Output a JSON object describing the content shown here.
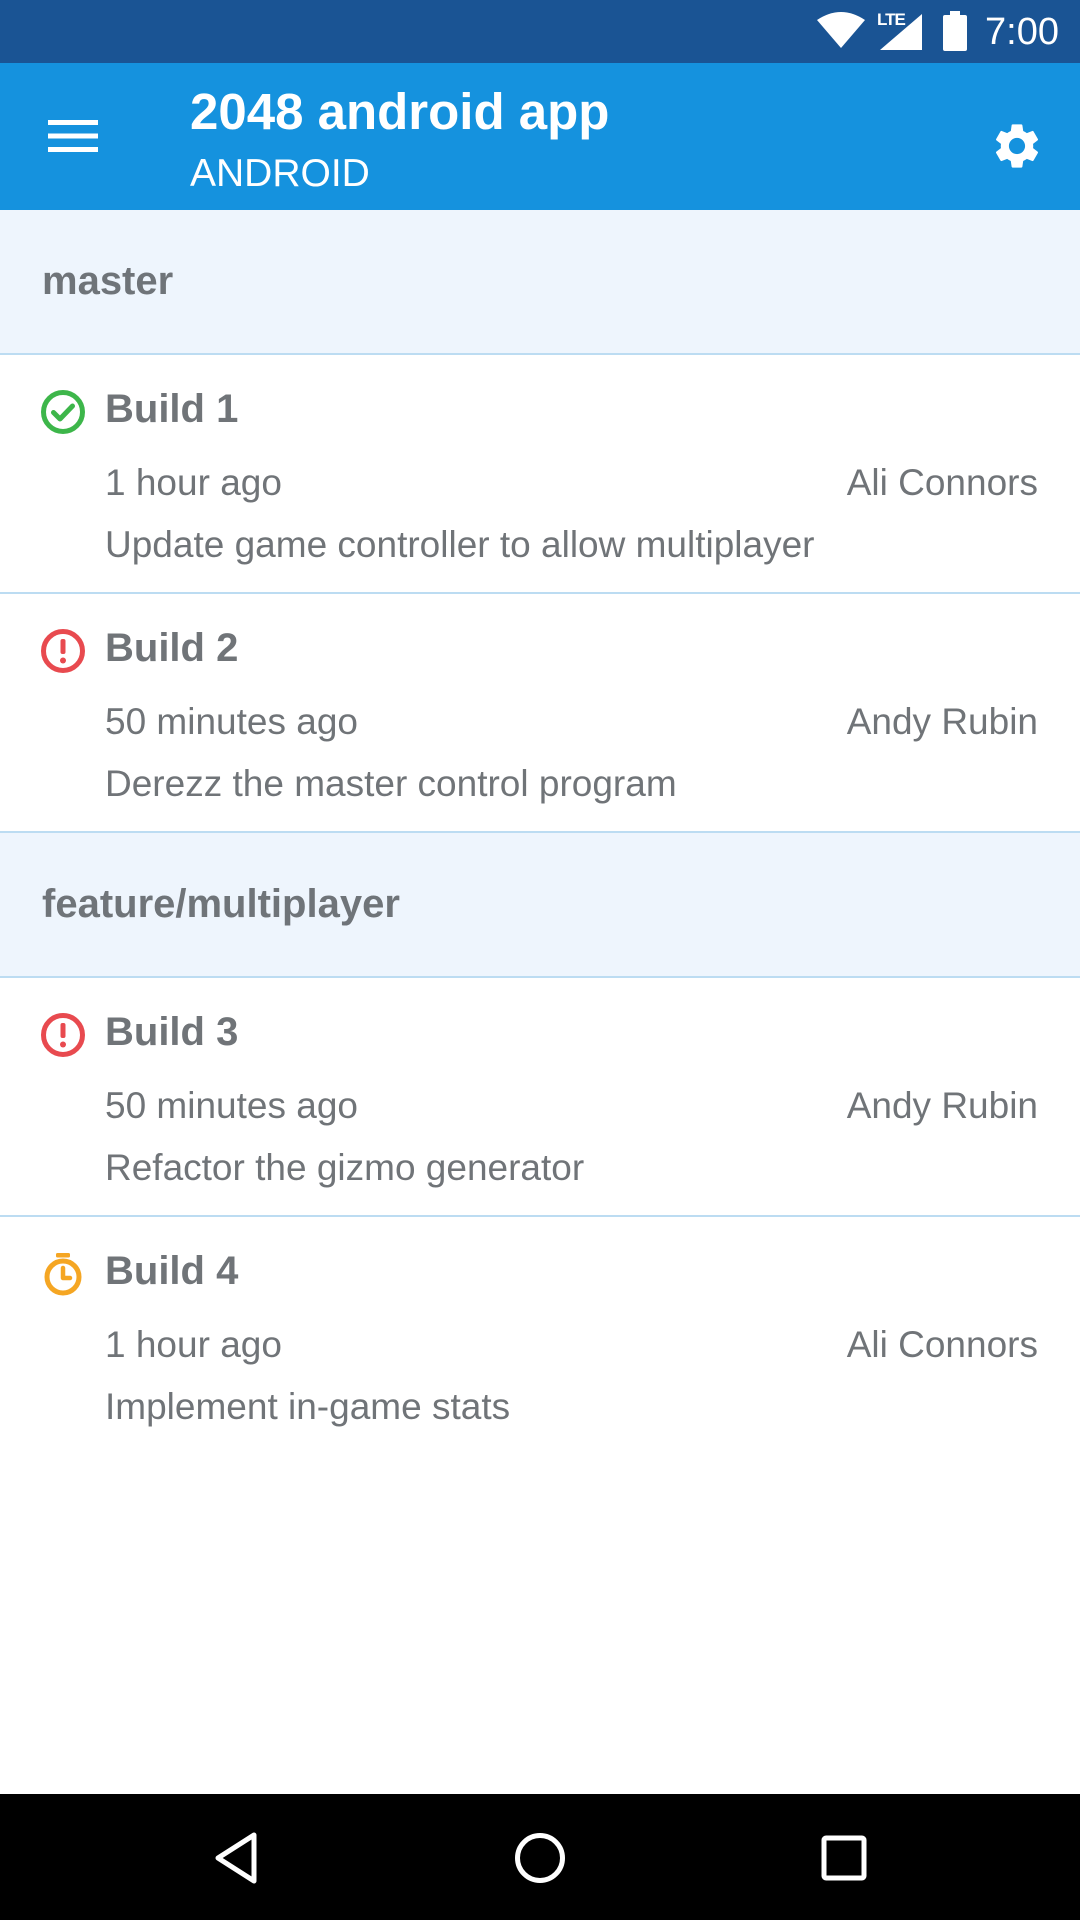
{
  "status_bar": {
    "network_label": "LTE",
    "time": "7:00",
    "icons": [
      "wifi-icon",
      "cell-signal-icon",
      "battery-icon"
    ]
  },
  "app_bar": {
    "title": "2048 android app",
    "subtitle": "ANDROID",
    "color": "#1592de",
    "icons": [
      "menu-icon",
      "gear-icon"
    ]
  },
  "sections": [
    {
      "label": "master",
      "builds": [
        {
          "name": "Build 1",
          "status": "success",
          "time": "1 hour ago",
          "author": "Ali Connors",
          "message": "Update game controller to allow multiplayer"
        },
        {
          "name": "Build 2",
          "status": "failed",
          "time": "50 minutes ago",
          "author": "Andy Rubin",
          "message": "Derezz the master control program"
        }
      ]
    },
    {
      "label": "feature/multiplayer",
      "builds": [
        {
          "name": "Build 3",
          "status": "failed",
          "time": "50 minutes ago",
          "author": "Andy Rubin",
          "message": "Refactor the gizmo generator"
        },
        {
          "name": "Build 4",
          "status": "pending",
          "time": "1 hour ago",
          "author": "Ali Connors",
          "message": "Implement in-game stats"
        }
      ]
    }
  ],
  "status_colors": {
    "success": "#3db64a",
    "failed": "#e84a4f",
    "pending": "#f5a623"
  },
  "nav_bar": {
    "icons": [
      "back-icon",
      "home-icon",
      "recents-icon"
    ]
  }
}
